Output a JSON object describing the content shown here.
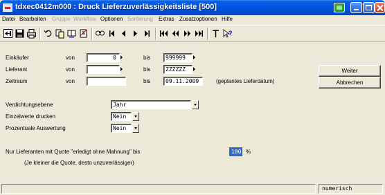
{
  "window": {
    "title": "tdxec0412m000 : Druck Lieferzuverlässigkeitsliste [500]"
  },
  "menu": [
    {
      "label": "Datei",
      "enabled": true
    },
    {
      "label": "Bearbeiten",
      "enabled": true
    },
    {
      "label": "Gruppe",
      "enabled": false
    },
    {
      "label": "Workflow",
      "enabled": false
    },
    {
      "label": "Optionen",
      "enabled": true
    },
    {
      "label": "Sortierung",
      "enabled": false
    },
    {
      "label": "Extras",
      "enabled": true
    },
    {
      "label": "Zusatzoptionen",
      "enabled": true
    },
    {
      "label": "Hilfe",
      "enabled": true
    }
  ],
  "toolbar": {
    "icons": [
      "exit-icon",
      "save-icon",
      "print-icon",
      "undo-icon",
      "copy-record-icon",
      "duplicate-icon",
      "delete-record-icon",
      "find-icon",
      "first-record-icon",
      "previous-record-icon",
      "next-record-icon",
      "last-record-icon",
      "first-group-icon",
      "previous-group-icon",
      "next-group-icon",
      "last-group-icon",
      "text-icon",
      "help-icon"
    ]
  },
  "form": {
    "einkaeufer": {
      "label": "Einkäufer",
      "from_label": "von",
      "from_value": "0",
      "to_label": "bis",
      "to_value": "999999"
    },
    "lieferant": {
      "label": "Lieferant",
      "from_label": "von",
      "from_value": "",
      "to_label": "bis",
      "to_value": "ZZZZZZ"
    },
    "zeitraum": {
      "label": "Zeitraum",
      "from_label": "von",
      "from_value": "",
      "to_label": "bis",
      "to_value": "09.11.2009",
      "note": "(geplantes Lieferdatum)"
    },
    "verdichtungsebene": {
      "label": "Verdichtungsebene",
      "value": "Jahr"
    },
    "einzelwerte": {
      "label": "Einzelwerte drucken",
      "value": "Nein"
    },
    "prozentual": {
      "label": "Prozentuale Auswertung",
      "value": "Nein"
    },
    "quote": {
      "label": "Nur Lieferanten mit Quote \"erledigt ohne Mahnung\" bis",
      "value": "100",
      "unit": "%",
      "hint": "(Je kleiner die Quote, desto unzuverlässiger)"
    }
  },
  "buttons": {
    "continue": "Weiter",
    "cancel": "Abbrechen"
  },
  "statusbar": {
    "mode": "numerisch"
  },
  "colors": {
    "titlebar": "#0054e3",
    "background": "#ece9d8",
    "selection": "#316ac5"
  }
}
